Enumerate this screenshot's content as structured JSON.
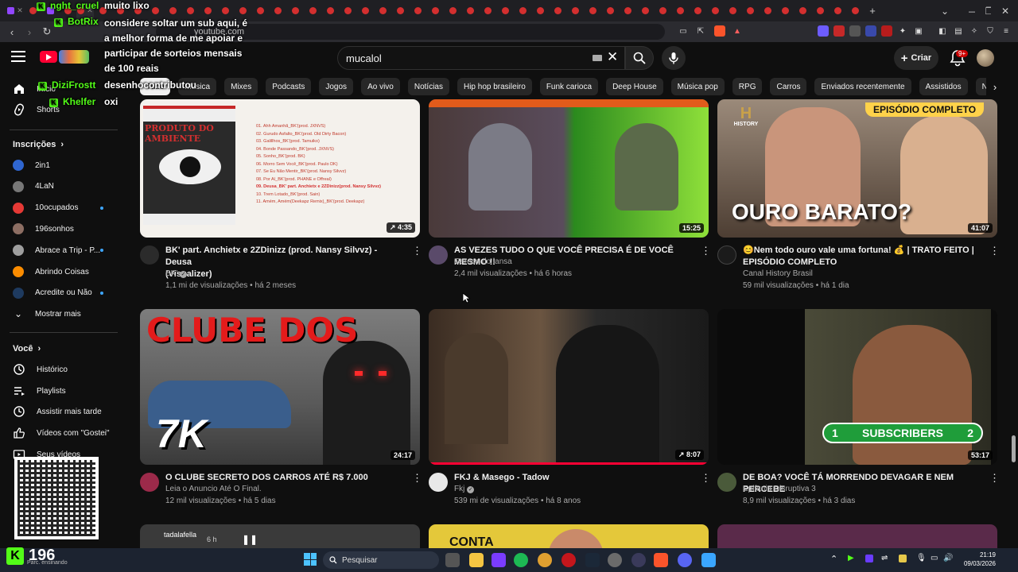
{
  "browser": {
    "url": "youtube.com",
    "window_controls": {
      "minimize": "—",
      "maximize": "❐",
      "close": "✕"
    }
  },
  "header": {
    "search_value": "mucalol",
    "create_label": "Criar",
    "notification_count": "9+"
  },
  "chips": [
    "Tudo",
    "Música",
    "Mixes",
    "Podcasts",
    "Jogos",
    "Ao vivo",
    "Notícias",
    "Hip hop brasileiro",
    "Funk carioca",
    "Deep House",
    "Música pop",
    "RPG",
    "Carros",
    "Enviados recentemente",
    "Assistidos",
    "Novidades para você"
  ],
  "sidebar": {
    "home": "Início",
    "shorts": "Shorts",
    "subscriptions_title": "Inscrições",
    "subscriptions": [
      {
        "name": "2in1",
        "color": "#2f66d0",
        "new": false
      },
      {
        "name": "4LaN",
        "color": "#777777",
        "new": false
      },
      {
        "name": "10ocupados",
        "color": "#e53935",
        "new": true
      },
      {
        "name": "196sonhos",
        "color": "#8d6e63",
        "new": false
      },
      {
        "name": "Abrace a Trip - P...",
        "color": "#9e9e9e",
        "new": true
      },
      {
        "name": "Abrindo Coisas",
        "color": "#fb8c00",
        "new": false
      },
      {
        "name": "Acredite ou Não",
        "color": "#1e3a5f",
        "new": true
      }
    ],
    "show_more": "Mostrar mais",
    "you_title": "Você",
    "you_items": [
      "Histórico",
      "Playlists",
      "Assistir mais tarde",
      "Vídeos com \"Gostei\"",
      "Seus vídeos"
    ]
  },
  "videos": [
    {
      "title_1": "BK' part. Anchietx e 2ZDinizz (prod. Nansy Silvvz) - Deusa",
      "title_2": "(Visualizer)",
      "channel": "BK'",
      "verified": true,
      "meta": "1,1 mi de visualizações • há 2 meses",
      "duration": "4:35",
      "short_icon": true
    },
    {
      "title_1": "AS VEZES TUDO O QUE VOCÊ PRECISA É DE VOCÊ MESMO !!",
      "title_2": "",
      "channel": "Careca do lansa",
      "verified": false,
      "meta": "2,4 mil visualizações • há 6 horas",
      "duration": "15:25",
      "short_icon": false
    },
    {
      "title_1": "😊Nem todo ouro vale uma fortuna! 💰 | TRATO FEITO |",
      "title_2": "EPISÓDIO COMPLETO",
      "channel": "Canal History Brasil",
      "verified": false,
      "meta": "59 mil visualizações • há 1 dia",
      "duration": "41:07",
      "short_icon": false
    },
    {
      "title_1": "O CLUBE SECRETO DOS CARROS ATÉ R$ 7.000",
      "title_2": "",
      "channel": "Leia o Anuncio Até O Final.",
      "verified": false,
      "meta": "12 mil visualizações • há 5 dias",
      "duration": "24:17",
      "short_icon": false
    },
    {
      "title_1": "FKJ & Masego - Tadow",
      "title_2": "",
      "channel": "Fkj",
      "verified": true,
      "meta": "539 mi de visualizações • há 8 anos",
      "duration": "8:07",
      "short_icon": true
    },
    {
      "title_1": "DE BOA? VOCÊ TÁ MORRENDO DEVAGAR E NEM PERCEBE",
      "title_2": "",
      "channel": "Epifania Disruptiva 3",
      "verified": false,
      "meta": "8,9 mil visualizações • há 3 dias",
      "duration": "53:17",
      "short_icon": false
    }
  ],
  "thumb_text": {
    "bk_cover_title": "PRODUTO DO AMBIENTE",
    "bk_tracklist": [
      "01. Ahh Amanhã_BK'(prod. JXNVS)",
      "02. Gurudo Asfalto_BK'(prod. Old Dirty Bacon)",
      "03. Galillhos_BK'(prod. Tamuiko)",
      "04. Bonde Passando_BK'(prod. JXNVS)",
      "05. Sonho_BK'(prod. BK)",
      "06. Morro Sem Você_BK'(prod. Paulo DK)",
      "07. Se Eu Não Mentir_BK'(prod. Nansy Silvvz)",
      "08. Por Aí_BK'(prod. PHANE e Offreal)",
      "09. Deusa_BK' part. Anchietx e 2ZDinizz(prod. Nansy Silvvz)",
      "10. Trem Lotado_BK'(prod. Sain)",
      "11. Amém, Amém(Deekapz Remix)_BK'(prod. Deekapz)"
    ],
    "history_banner": "EPISÓDIO COMPLETO",
    "history_logo": "HISTORY",
    "ouro": "OURO BARATO?",
    "clube": "CLUBE DOS",
    "seven_k": "7K",
    "subs_left": "1",
    "subs_label": "SUBSCRIBERS",
    "subs_right": "2",
    "conta": "CONTA"
  },
  "mini_player": {
    "channel": "tadalafella",
    "time": "6 h"
  },
  "chat": [
    {
      "name": "nght_cruel",
      "text": "muito lixo"
    },
    {
      "name": "BotRix",
      "text": "considere soltar um sub aqui, é a melhor forma de me apoiar e participar de sorteios mensais de 100 reais"
    },
    {
      "name": "DiziFrostt",
      "text": "desenhocontributou"
    },
    {
      "name": "Khelfer",
      "text": "oxi"
    }
  ],
  "stream": {
    "viewers": "196",
    "status": "Parc. ensinando"
  },
  "taskbar": {
    "search": "Pesquisar",
    "time": "21:19",
    "date": "09/03/2026"
  },
  "colors": {
    "kick_green": "#53fc18",
    "yt_red": "#ff0033",
    "bg": "#0f0f0f"
  }
}
